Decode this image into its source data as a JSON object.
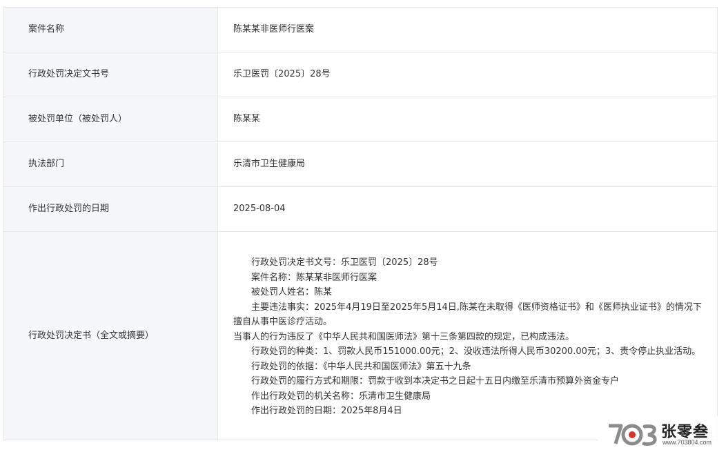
{
  "rows": [
    {
      "label": "案件名称",
      "value": "陈某某非医师行医案"
    },
    {
      "label": "行政处罚决定文书号",
      "value": "乐卫医罚〔2025〕28号"
    },
    {
      "label": "被处罚单位（被处罚人）",
      "value": "陈某某"
    },
    {
      "label": "执法部门",
      "value": "乐清市卫生健康局"
    },
    {
      "label": "作出行政处罚的日期",
      "value": "2025-08-04"
    }
  ],
  "full_decision": {
    "label": "行政处罚决定书（全文或摘要）",
    "paragraphs": [
      "行政处罚决定书文号：乐卫医罚〔2025〕28号",
      "案件名称：陈某某非医师行医案",
      "被处罚人姓名：陈某",
      "主要违法事实：2025年4月19日至2025年5月14日,陈某在未取得《医师资格证书》和《医师执业证书》的情况下擅自从事中医诊疗活动。",
      "当事人的行为违反了《中华人民共和国医师法》第十三条第四款的规定，已构成违法。",
      "行政处罚的种类：1、罚款人民币151000.00元；2、没收违法所得人民币30200.00元；3、责令停止执业活动。",
      "行政处罚的依据：《中华人民共和国医师法》第五十九条",
      "行政处罚的履行方式和期限：罚款于收到本决定书之日起十五日内缴至乐清市预算外资金专户",
      "作出行政处罚的机关名称：乐清市卫生健康局",
      "作出行政处罚的日期：2025年8月4日"
    ]
  },
  "watermark": {
    "logo_mark": "703",
    "name": "张零叁",
    "url": "www.703804.com",
    "colors": {
      "ring": "#8c8c8c",
      "accent": "#d9322b",
      "text": "#222222"
    }
  }
}
